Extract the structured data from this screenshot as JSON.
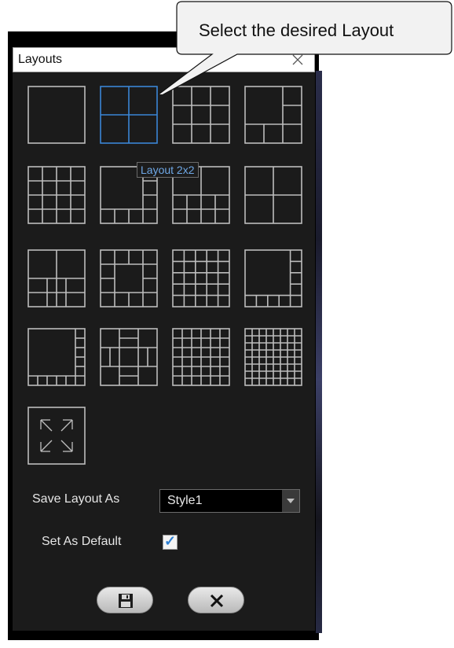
{
  "callout": {
    "text": "Select the desired Layout"
  },
  "dialog": {
    "title": "Layouts"
  },
  "layouts": [
    {
      "name": "Layout 1x1"
    },
    {
      "name": "Layout 2x2"
    },
    {
      "name": "Layout 3x3"
    },
    {
      "name": "Layout 1+5"
    },
    {
      "name": "Layout 4x4"
    },
    {
      "name": "Layout 1+7"
    },
    {
      "name": "Layout 2+8"
    },
    {
      "name": "Layout 1+3"
    },
    {
      "name": "Layout 2+6"
    },
    {
      "name": "Layout 1+12"
    },
    {
      "name": "Layout 5x5"
    },
    {
      "name": "Layout 1+16"
    },
    {
      "name": "Layout 1+9"
    },
    {
      "name": "Layout 4+12"
    },
    {
      "name": "Layout 6x6"
    },
    {
      "name": "Layout 8x8"
    },
    {
      "name": "Fullscreen"
    }
  ],
  "selected_layout": "Layout 2x2",
  "tooltip": {
    "text": "Layout 2x2"
  },
  "save": {
    "label": "Save Layout As",
    "value": "Style1"
  },
  "default": {
    "label": "Set As Default",
    "checked": true
  },
  "buttons": {
    "save_icon": "floppy-disk-icon",
    "cancel_icon": "x-icon"
  },
  "colors": {
    "selected": "#3b86d6",
    "grid": "#bdbdbd",
    "background": "#1b1b1b"
  }
}
